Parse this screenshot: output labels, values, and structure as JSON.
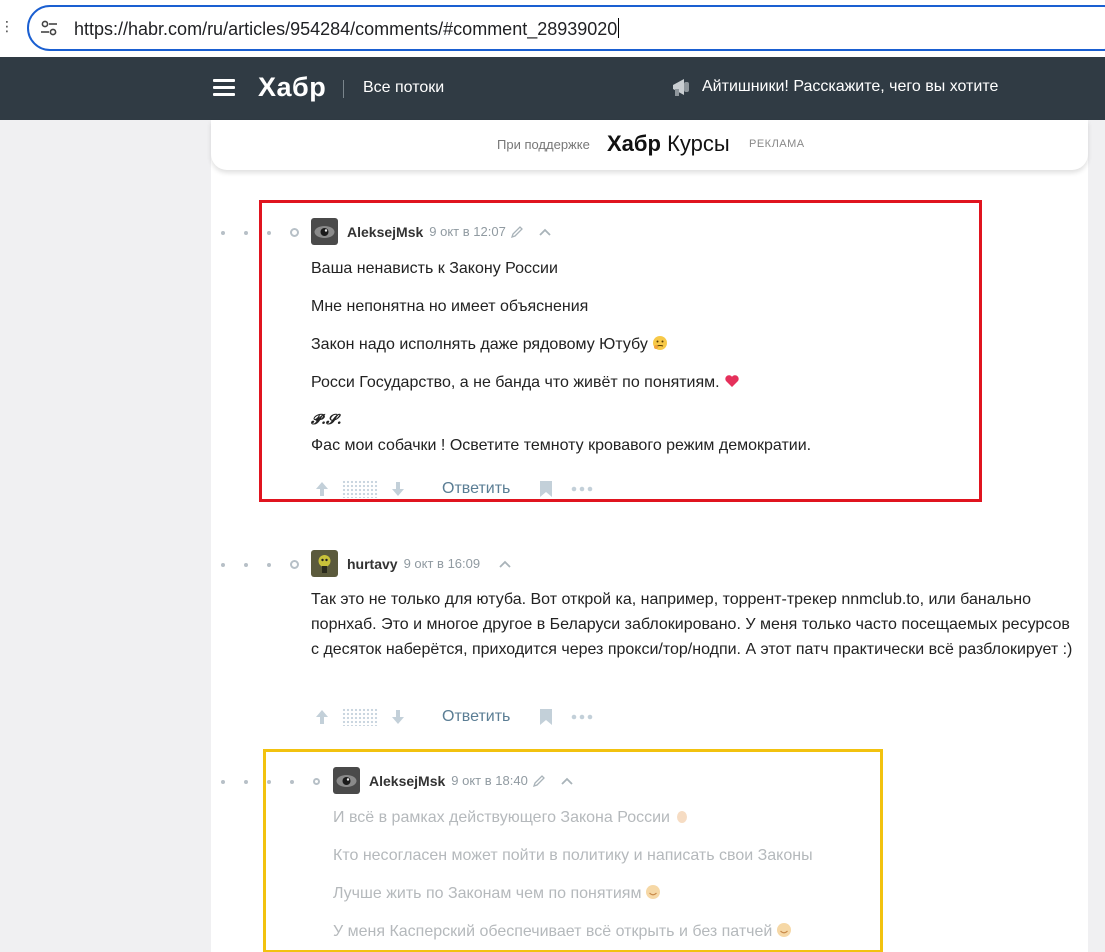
{
  "browser": {
    "url": "https://habr.com/ru/articles/954284/comments/#comment_28939020",
    "edge_glyph": "⋮"
  },
  "header": {
    "logo": "Хабр",
    "nav_label": "Все потоки",
    "promo_text": "Айтишники! Расскажите, чего вы хотите"
  },
  "sponsor": {
    "text": "При поддержке",
    "logo_bold": "Хабр",
    "logo_rest": "Курсы",
    "ad_label": "РЕКЛАМА"
  },
  "comments": [
    {
      "author": "AleksejMsk",
      "date": "9 окт в 12:07",
      "edited": true,
      "paragraphs": [
        "Ваша ненависть к Закону России",
        "Мне непонятна но имеет объяснения",
        "Закон надо исполнять даже рядовому Ютубу",
        "Росси Государство, а не банда что живёт по понятиям."
      ],
      "ps_label": "𝓟.𝓢.",
      "ps_text": "Фас мои собачки ! Осветите темноту кровавого режим демократии.",
      "reply_label": "Ответить"
    },
    {
      "author": "hurtavy",
      "date": "9 окт в 16:09",
      "edited": false,
      "paragraphs": [
        "Так это не только для ютуба. Вот открой ка, например, торрент-трекер nnmclub.to, или банально порнхаб. Это и многое другое в Беларуси заблокировано. У меня только часто посещаемых ресурсов с десяток наберётся, приходится через прокси/тор/нодпи. А этот патч практически всё разблокирует :)"
      ],
      "reply_label": "Ответить"
    },
    {
      "author": "AleksejMsk",
      "date": "9 окт в 18:40",
      "edited": true,
      "paragraphs": [
        "И всё в рамках действующего Закона России",
        "Кто несогласен может пойти в политику и написать свои Законы",
        "Лучше жить по Законам чем по понятиям",
        "У меня Касперский обеспечивает всё открыть и без патчей"
      ]
    }
  ],
  "colors": {
    "header_bg": "#303b44",
    "highlight_red": "#e0141f",
    "highlight_yellow": "#f2c20f",
    "reply_link": "#5a7d94",
    "address_border": "#1a5fd1"
  }
}
